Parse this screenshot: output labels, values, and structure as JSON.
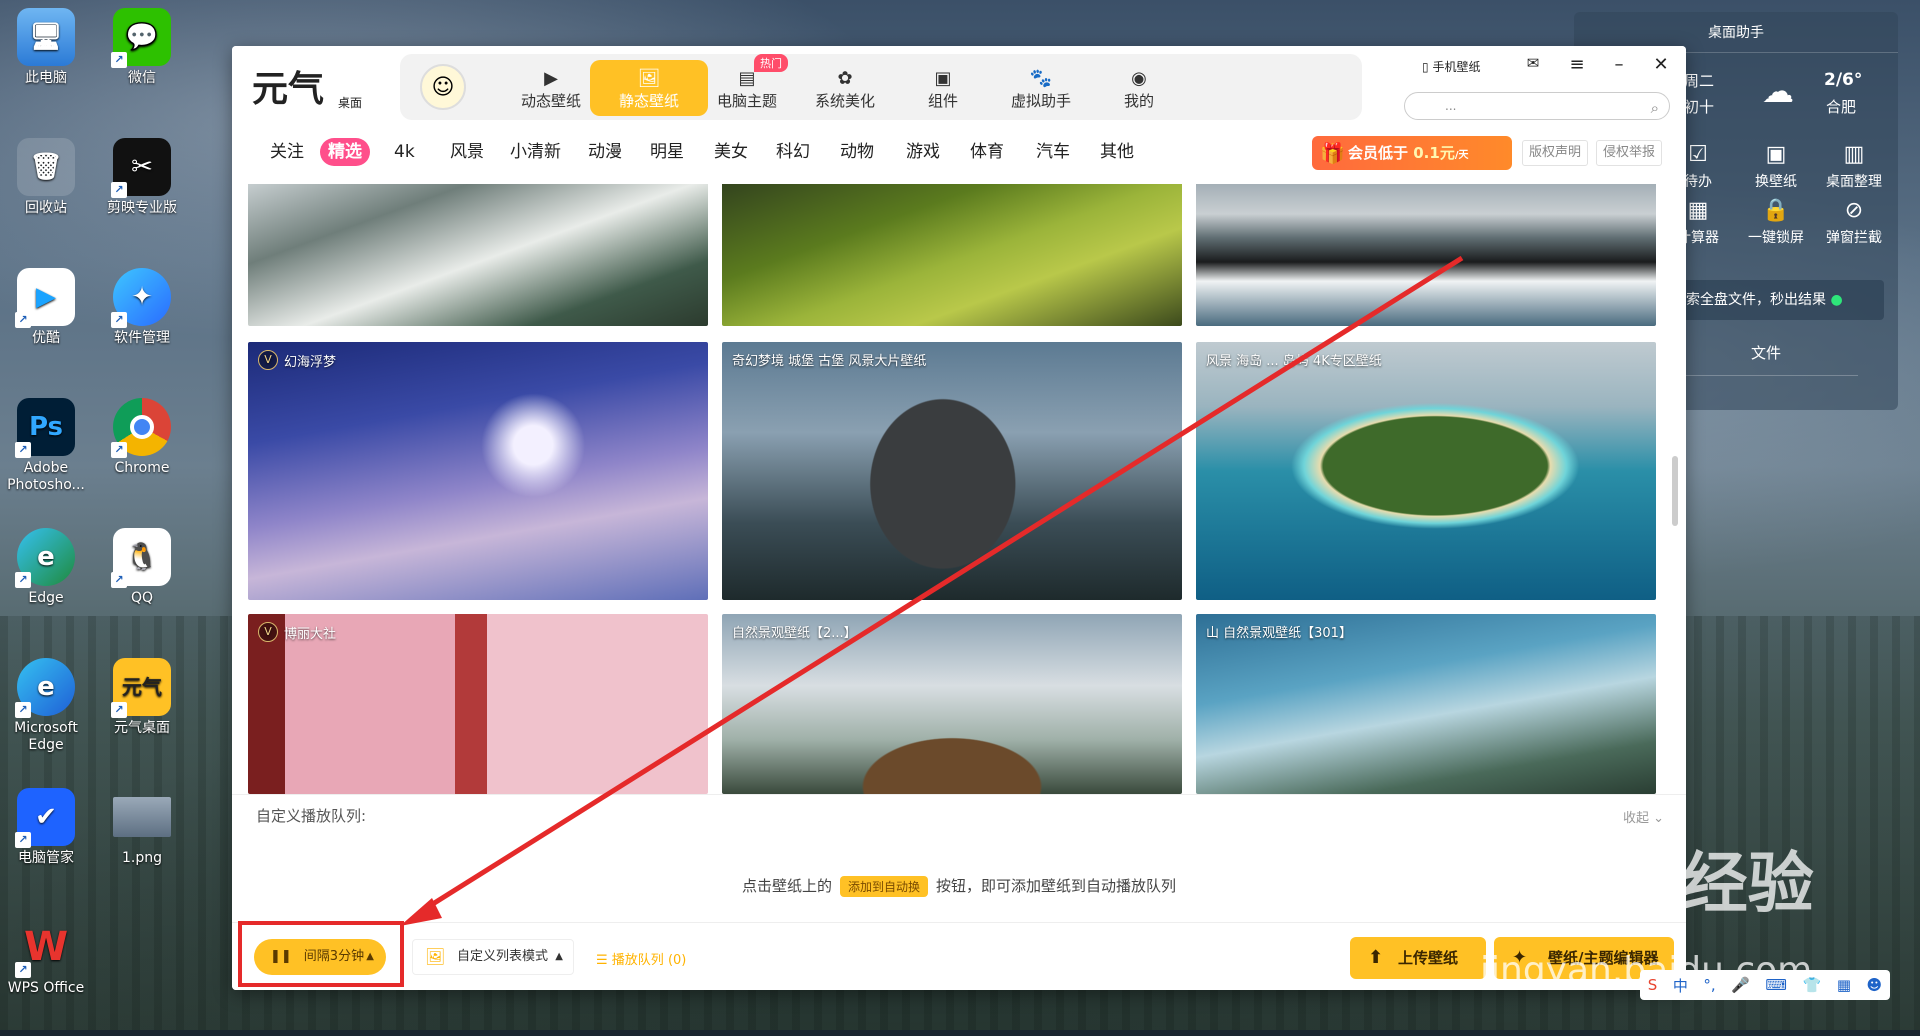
{
  "desktop": {
    "icons": [
      {
        "label": "此电脑",
        "icon": "computer-icon"
      },
      {
        "label": "微信",
        "icon": "wechat-icon"
      },
      {
        "label": "回收站",
        "icon": "recycle-bin-icon"
      },
      {
        "label": "剪映专业版",
        "icon": "capcut-icon"
      },
      {
        "label": "优酷",
        "icon": "youku-icon"
      },
      {
        "label": "软件管理",
        "icon": "software-manager-icon"
      },
      {
        "label": "Adobe Photosho...",
        "icon": "photoshop-icon",
        "glyph": "Ps"
      },
      {
        "label": "Chrome",
        "icon": "chrome-icon"
      },
      {
        "label": "Edge",
        "icon": "edge-icon"
      },
      {
        "label": "QQ",
        "icon": "qq-icon"
      },
      {
        "label": "Microsoft Edge",
        "icon": "edge-icon"
      },
      {
        "label": "元气桌面",
        "icon": "yuanqi-icon",
        "glyph": "元气"
      },
      {
        "label": "电脑管家",
        "icon": "pc-manager-icon"
      },
      {
        "label": "1.png",
        "icon": "image-file-icon"
      },
      {
        "label": "WPS Office",
        "icon": "wps-icon",
        "glyph": "W"
      }
    ]
  },
  "widget": {
    "title": "桌面助手",
    "weekday": "周二",
    "lunar": "初十",
    "temp": "2/6°",
    "city": "合肥",
    "items": [
      {
        "label": "待办",
        "icon": "todo-icon"
      },
      {
        "label": "换壁纸",
        "icon": "wallpaper-icon"
      },
      {
        "label": "桌面整理",
        "icon": "organize-icon"
      },
      {
        "label": "计算器",
        "icon": "calculator-icon"
      },
      {
        "label": "一键锁屏",
        "icon": "lock-icon"
      },
      {
        "label": "弹窗拦截",
        "icon": "block-icon"
      }
    ],
    "search_row": "索全盘文件，秒出结果",
    "file_label": "文件"
  },
  "app": {
    "logo": "元气",
    "logo_sub": "桌面",
    "nav": [
      {
        "label": "动态壁纸",
        "icon": "play-icon"
      },
      {
        "label": "静态壁纸",
        "icon": "image-icon",
        "active": true
      },
      {
        "label": "电脑主题",
        "icon": "theme-icon",
        "badge": "热门"
      },
      {
        "label": "系统美化",
        "icon": "beautify-icon"
      },
      {
        "label": "组件",
        "icon": "widget-icon"
      },
      {
        "label": "虚拟助手",
        "icon": "paw-icon"
      },
      {
        "label": "我的",
        "icon": "user-icon"
      }
    ],
    "phone_wallpaper": "手机壁纸",
    "search_placeholder": "...",
    "categories": [
      "关注",
      "精选",
      "4k",
      "风景",
      "小清新",
      "动漫",
      "明星",
      "美女",
      "科幻",
      "动物",
      "游戏",
      "体育",
      "汽车",
      "其他"
    ],
    "active_category": "精选",
    "vip_banner": "会员低于",
    "vip_price": "0.1元",
    "vip_unit": "/天",
    "copyright": "版权声明",
    "report": "侵权举报"
  },
  "gallery": {
    "tiles": [
      {
        "label": "",
        "vip": false
      },
      {
        "label": "",
        "vip": false
      },
      {
        "label": "",
        "vip": false
      },
      {
        "label": "幻海浮梦",
        "vip": true
      },
      {
        "label": "奇幻梦境 城堡 古堡 风景大片壁纸",
        "vip": false
      },
      {
        "label": "风景 海岛 ... 岛屿 4K专区壁纸",
        "vip": false
      },
      {
        "label": "博丽大社",
        "vip": true
      },
      {
        "label": "自然景观壁纸【2...】",
        "vip": false
      },
      {
        "label": "山 自然景观壁纸【301】",
        "vip": false
      }
    ]
  },
  "queue": {
    "title": "自定义播放队列:",
    "collapse": "收起",
    "hint_before": "点击壁纸上的",
    "hint_tag": "添加到自动换",
    "hint_after": "按钮，即可添加壁纸到自动播放队列"
  },
  "footer": {
    "interval": "间隔3分钟",
    "list_mode": "自定义列表模式",
    "play_queue": "播放队列",
    "play_queue_count": "(0)",
    "upload": "上传壁纸",
    "editor": "壁纸/主题编辑器"
  },
  "watermark": {
    "text": "Baidu经验",
    "url": "jingyan.baidu.com"
  },
  "tray": {
    "ime": "中"
  },
  "colors": {
    "accent": "#ffc125",
    "category_active": "#ff4f8b",
    "annotation_red": "#e52a2a"
  }
}
